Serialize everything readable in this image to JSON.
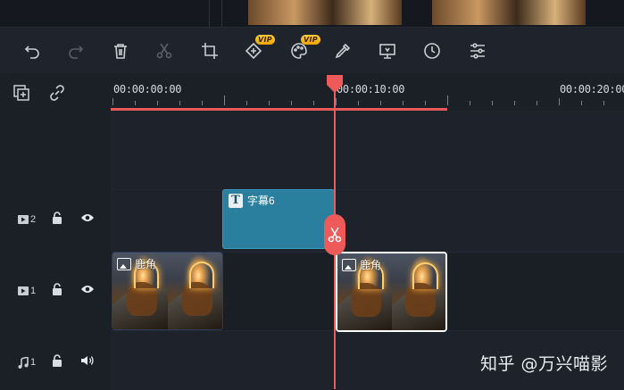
{
  "toolbar": {
    "vip_badge_1": "VIP",
    "vip_badge_2": "VIP",
    "icons": [
      "undo-icon",
      "redo-icon",
      "delete-icon",
      "cut-icon",
      "crop-icon",
      "add-effect-icon",
      "color-palette-icon",
      "eyedropper-icon",
      "display-icon",
      "clock-icon",
      "adjust-sliders-icon"
    ]
  },
  "track_controls": {
    "add_track_icon": "add-track-icon",
    "link_icon": "link-icon"
  },
  "ruler": {
    "timecodes": [
      "00:00:00:00",
      "00:00:10:00",
      "00:00:20:00"
    ]
  },
  "tracks": [
    {
      "id": "text-track",
      "name": "2",
      "type": "video"
    },
    {
      "id": "video-track",
      "name": "1",
      "type": "video"
    },
    {
      "id": "audio-track",
      "name": "1",
      "type": "audio"
    }
  ],
  "clips": {
    "title_clip": {
      "label": "字幕6",
      "icon_letter": "T"
    },
    "deer_clip_1": {
      "label": "鹿角"
    },
    "deer_clip_2": {
      "label": "鹿角"
    }
  },
  "watermark": "知乎 @万兴喵影",
  "colors": {
    "playhead": "#ee5a5a",
    "title_clip": "#2a7f9e",
    "vip_badge": "#f5b400"
  }
}
